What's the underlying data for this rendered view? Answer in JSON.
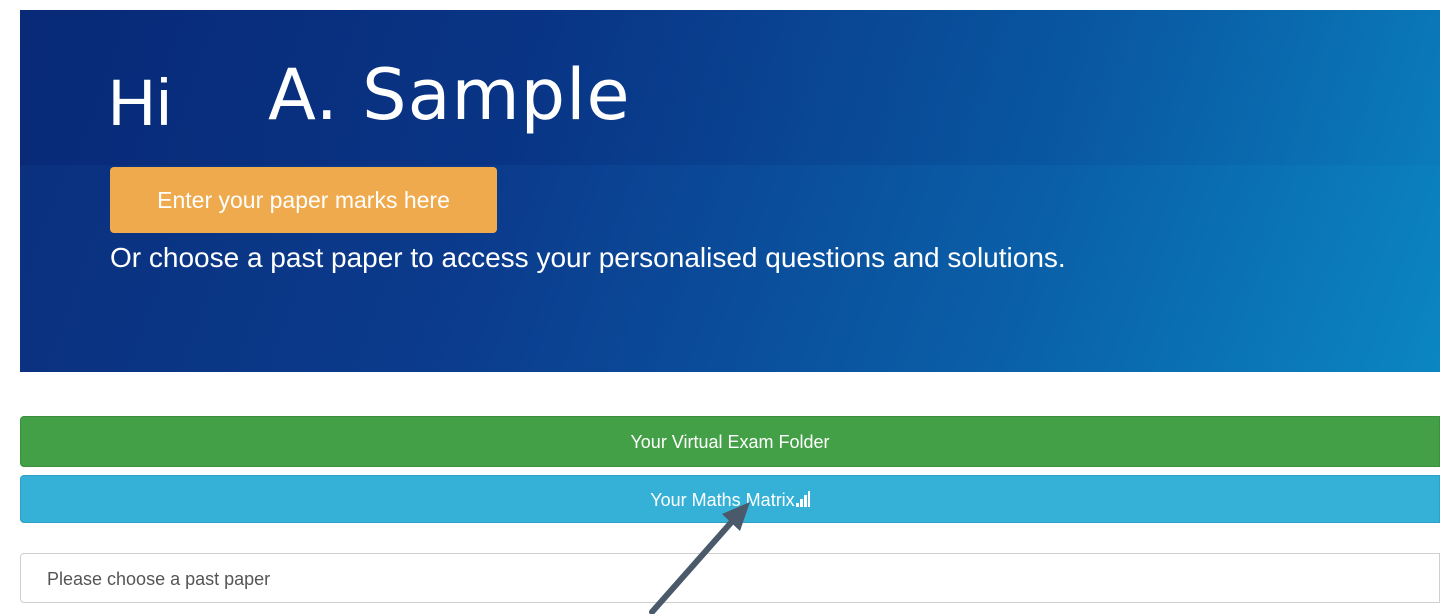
{
  "hero": {
    "greeting": "Hi",
    "user_name": "A. Sample",
    "enter_marks_label": "Enter your paper marks here",
    "subtext": "Or choose a past paper to access your personalised questions and solutions."
  },
  "actions": {
    "exam_folder_label": "Your Virtual Exam Folder",
    "maths_matrix_label": "Your Maths Matrix"
  },
  "paper_select": {
    "placeholder": "Please choose a past paper"
  },
  "icons": {
    "matrix_icon": "signal-bars-icon",
    "annotation": "arrow-icon"
  },
  "colors": {
    "hero_dark": "#0a2f7c",
    "hero_light": "#0b86c2",
    "enter_marks": "#eeaa4d",
    "exam_folder": "#43a047",
    "maths_matrix": "#35b1d7",
    "arrow": "#4a5a6a"
  }
}
